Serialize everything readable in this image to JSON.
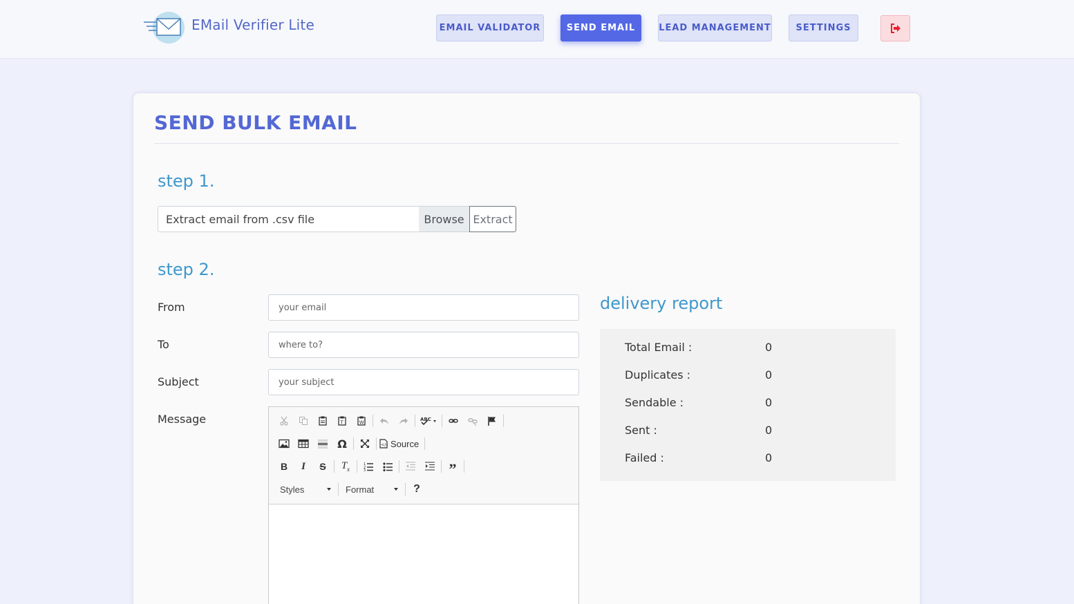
{
  "header": {
    "brand": "EMail Verifier Lite",
    "nav": [
      {
        "label": "EMAIL VALIDATOR",
        "active": false
      },
      {
        "label": "SEND EMAIL",
        "active": true
      },
      {
        "label": "LEAD MANAGEMENT",
        "active": false
      },
      {
        "label": "SETTINGS",
        "active": false
      }
    ],
    "logout_icon": "sign-out-icon"
  },
  "main": {
    "title": "SEND BULK EMAIL",
    "step1": {
      "title": "step 1.",
      "file_placeholder": "Extract email from .csv file",
      "browse_label": "Browse",
      "extract_label": "Extract"
    },
    "step2": {
      "title": "step 2.",
      "from_label": "From",
      "from_placeholder": "your email",
      "to_label": "To",
      "to_placeholder": "where to?",
      "subject_label": "Subject",
      "subject_placeholder": "your subject",
      "message_label": "Message"
    },
    "editor": {
      "source_label": "Source",
      "styles_label": "Styles",
      "format_label": "Format",
      "help_label": "?"
    },
    "report": {
      "title": "delivery report",
      "rows": [
        {
          "label": "Total Email :",
          "value": "0"
        },
        {
          "label": "Duplicates :",
          "value": "0"
        },
        {
          "label": "Sendable :",
          "value": "0"
        },
        {
          "label": "Sent :",
          "value": "0"
        },
        {
          "label": "Failed :",
          "value": "0"
        }
      ]
    }
  },
  "colors": {
    "accent": "#5468e6",
    "step": "#3f97cc",
    "logout": "#e8202e"
  }
}
